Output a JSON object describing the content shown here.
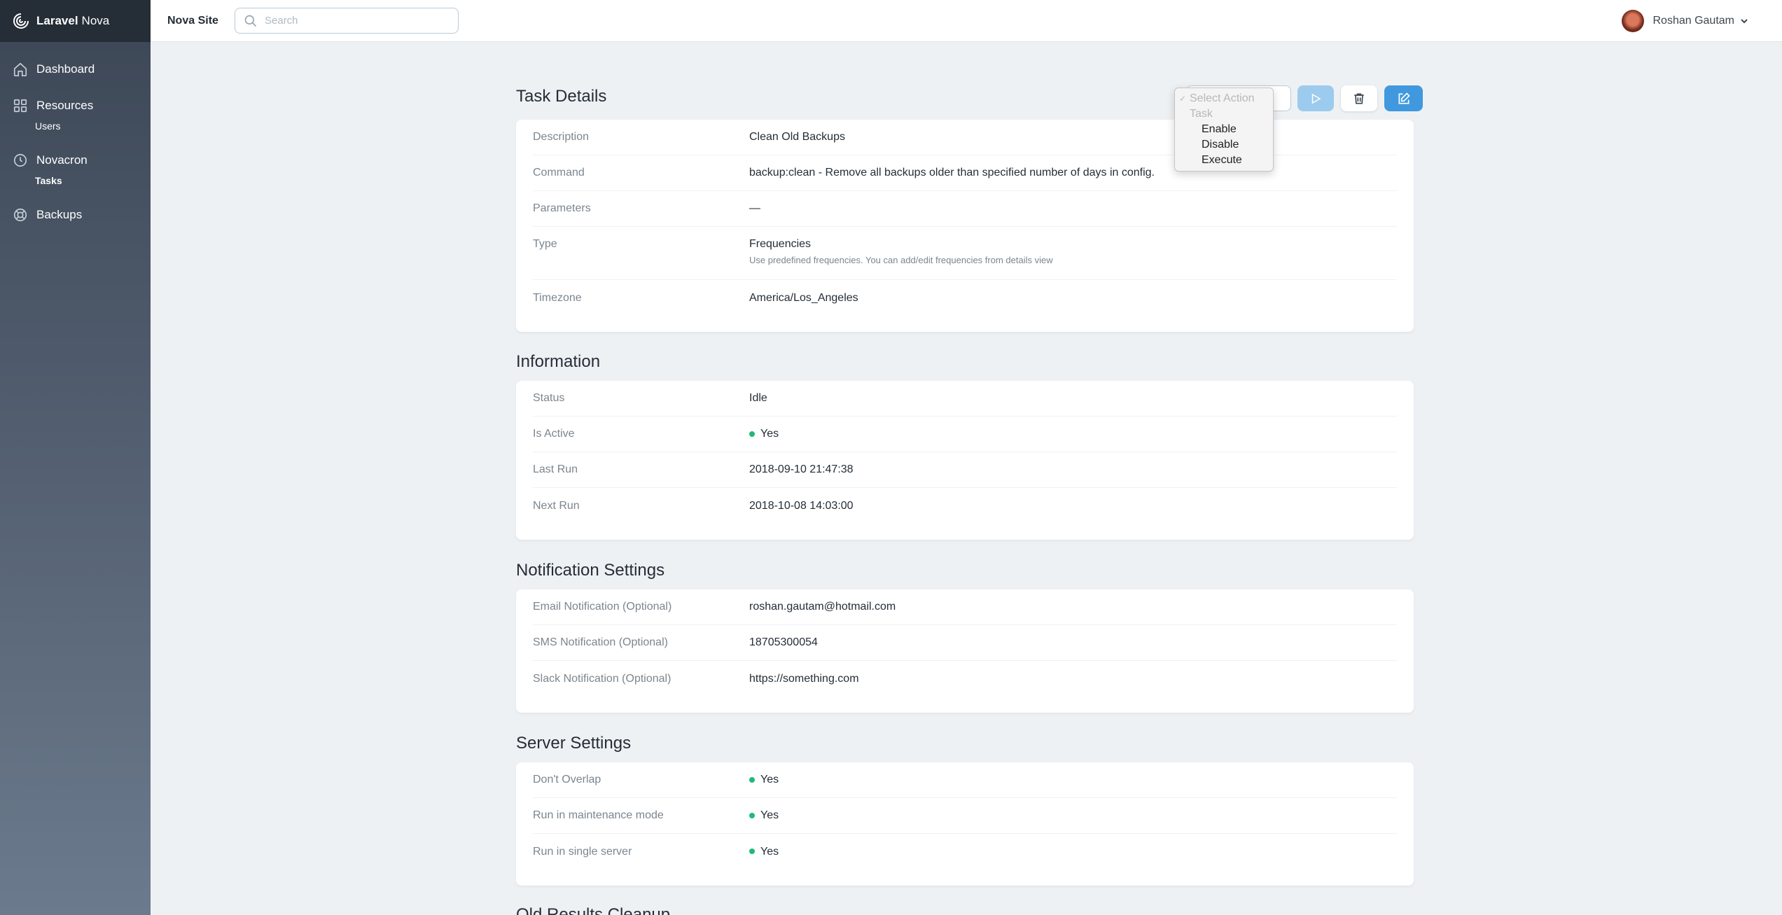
{
  "brand": {
    "name_bold": "Laravel",
    "name_light": "Nova"
  },
  "sidebar": {
    "items": [
      {
        "label": "Dashboard",
        "icon": "home-icon"
      },
      {
        "label": "Resources",
        "icon": "grid-icon"
      },
      {
        "label": "Users",
        "sub": true
      },
      {
        "label": "Novacron",
        "icon": "clock-icon"
      },
      {
        "label": "Tasks",
        "sub": true,
        "active": true
      },
      {
        "label": "Backups",
        "icon": "lifebuoy-icon"
      }
    ]
  },
  "header": {
    "site_name": "Nova Site",
    "search_placeholder": "Search",
    "user_name": "Roshan Gautam"
  },
  "task_details": {
    "title": "Task Details",
    "rows": [
      {
        "label": "Description",
        "value": "Clean Old Backups"
      },
      {
        "label": "Command",
        "value": "backup:clean - Remove all backups older than specified number of days in config."
      },
      {
        "label": "Parameters",
        "value": "—"
      },
      {
        "label": "Type",
        "value": "Frequencies",
        "help": "Use predefined frequencies. You can add/edit frequencies from details view"
      },
      {
        "label": "Timezone",
        "value": "America/Los_Angeles"
      }
    ]
  },
  "information": {
    "title": "Information",
    "rows": [
      {
        "label": "Status",
        "value": "Idle"
      },
      {
        "label": "Is Active",
        "value": "Yes"
      },
      {
        "label": "Last Run",
        "value": "2018-09-10 21:47:38"
      },
      {
        "label": "Next Run",
        "value": "2018-10-08 14:03:00"
      }
    ]
  },
  "notification_settings": {
    "title": "Notification Settings",
    "rows": [
      {
        "label": "Email Notification (Optional)",
        "value": "roshan.gautam@hotmail.com"
      },
      {
        "label": "SMS Notification (Optional)",
        "value": "18705300054"
      },
      {
        "label": "Slack Notification (Optional)",
        "value": "https://something.com"
      }
    ]
  },
  "server_settings": {
    "title": "Server Settings",
    "rows": [
      {
        "label": "Don't Overlap",
        "value": "Yes"
      },
      {
        "label": "Run in maintenance mode",
        "value": "Yes"
      },
      {
        "label": "Run in single server",
        "value": "Yes"
      }
    ]
  },
  "next_section_title": "Old Results Cleanup",
  "action_menu": {
    "selected": "Select Action",
    "group": "Task",
    "options": [
      "Enable",
      "Disable",
      "Execute"
    ]
  },
  "colors": {
    "primary": "#4099de",
    "active_dot": "#21b978",
    "sidebar_top": "#252d37"
  }
}
